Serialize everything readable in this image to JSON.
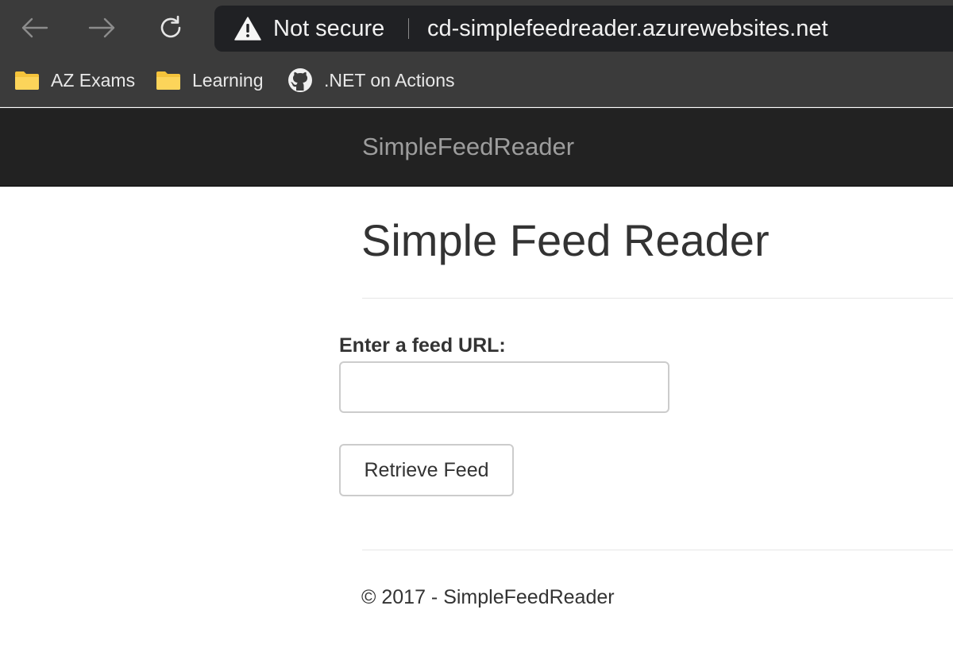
{
  "browser": {
    "security_label": "Not secure",
    "url": "cd-simplefeedreader.azurewebsites.net",
    "icons": {
      "back": "arrow-left-icon",
      "forward": "arrow-right-icon",
      "reload": "reload-icon",
      "security": "warning-triangle-icon"
    },
    "bookmarks": [
      {
        "label": "AZ Exams",
        "icon": "folder-icon"
      },
      {
        "label": "Learning",
        "icon": "folder-icon"
      },
      {
        "label": ".NET on Actions",
        "icon": "github-icon"
      }
    ]
  },
  "site": {
    "brand": "SimpleFeedReader",
    "page_title": "Simple Feed Reader",
    "form": {
      "label": "Enter a feed URL:",
      "input_value": "",
      "submit_label": "Retrieve Feed"
    },
    "footer": "© 2017 - SimpleFeedReader"
  },
  "colors": {
    "browser_chrome": "#3b3b3b",
    "address_bar": "#202124",
    "navbar": "#222222",
    "brand_text": "#9d9d9d",
    "body_text": "#333333",
    "folder": "#f5c33b"
  }
}
